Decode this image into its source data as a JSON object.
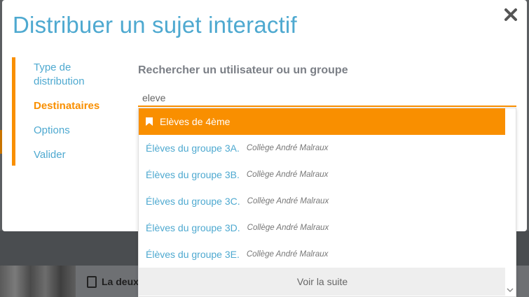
{
  "modal": {
    "title": "Distribuer un sujet interactif",
    "steps": [
      {
        "label": "Type de distribution"
      },
      {
        "label": "Destinataires"
      },
      {
        "label": "Options"
      },
      {
        "label": "Valider"
      }
    ],
    "active_step": "Destinataires",
    "search": {
      "heading": "Rechercher un utilisateur ou un groupe",
      "value": "eleve"
    },
    "results": [
      {
        "name": "Elèves de 4ème",
        "school": ""
      },
      {
        "name": "Élèves du groupe 3A.",
        "school": "Collège André Malraux"
      },
      {
        "name": "Élèves du groupe 3B.",
        "school": "Collège André Malraux"
      },
      {
        "name": "Élèves du groupe 3C.",
        "school": "Collège André Malraux"
      },
      {
        "name": "Élèves du groupe 3D.",
        "school": "Collège André Malraux"
      },
      {
        "name": "Élèves du groupe 3E.",
        "school": "Collège André Malraux"
      }
    ],
    "more_label": "Voir la suite"
  },
  "background": {
    "card_text": "La deux"
  },
  "colors": {
    "accent": "#f98f00",
    "link": "#4ea9d0",
    "heading_gray": "#7b7f86"
  }
}
